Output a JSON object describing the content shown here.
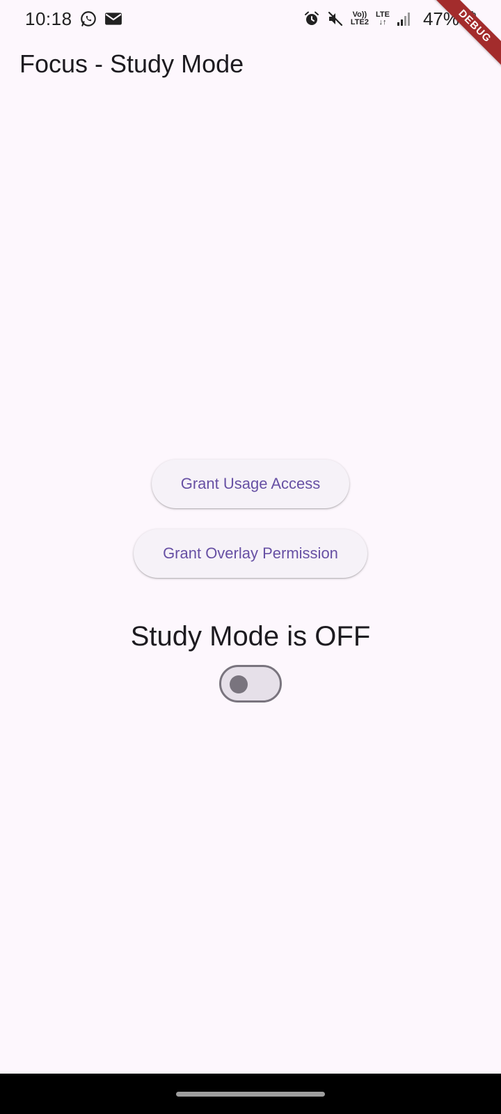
{
  "status_bar": {
    "time": "10:18",
    "lte_top": "Vo))",
    "lte_bottom": "LTE2",
    "lte2_top": "LTE",
    "lte2_bottom": "↓↑",
    "battery": "47%",
    "icons": [
      "whatsapp-icon",
      "mail-icon",
      "alarm-icon",
      "mute-icon",
      "signal-icon",
      "battery-icon"
    ]
  },
  "debug_banner": "DEBUG",
  "app_bar": {
    "title": "Focus - Study Mode"
  },
  "main": {
    "usage_button_label": "Grant Usage Access",
    "overlay_button_label": "Grant Overlay Permission",
    "mode_status": "Study Mode is OFF",
    "study_mode_switch_on": false
  },
  "colors": {
    "background": "#fdf7fd",
    "button_text": "#6750a4",
    "button_bg": "#f6f2f8",
    "switch_track": "#e6e0e9",
    "switch_outline": "#79747e",
    "debug_ribbon": "#a32c2c"
  }
}
